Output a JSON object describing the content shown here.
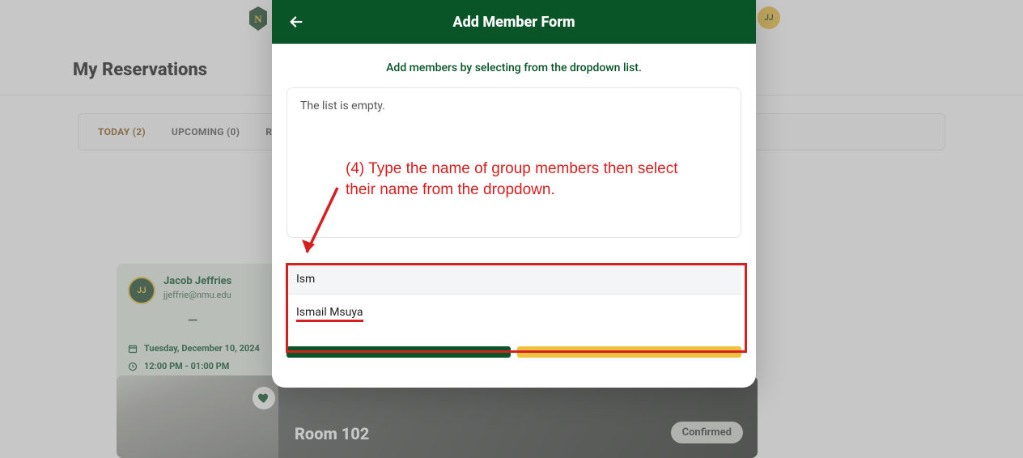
{
  "header": {
    "avatar_initials": "JJ"
  },
  "page": {
    "title": "My Reservations"
  },
  "tabs": {
    "today": "TODAY (2)",
    "upcoming": "UPCOMING (0)",
    "recurring_partial": "REC"
  },
  "card": {
    "avatar_initials": "JJ",
    "name": "Jacob Jeffries",
    "email": "jjeffrie@nmu.edu",
    "date": "Tuesday, December 10, 2024",
    "time": "12:00 PM - 01:00 PM"
  },
  "room": {
    "name": "Room 102",
    "status": "Confirmed"
  },
  "modal": {
    "title": "Add Member Form",
    "subtitle": "Add members by selecting from the dropdown list.",
    "empty_text": "The list is empty.",
    "search_value": "Ism",
    "dropdown_option": "Ismail Msuya"
  },
  "annotation": {
    "text": "(4) Type the name of group members then select their name from the dropdown."
  }
}
